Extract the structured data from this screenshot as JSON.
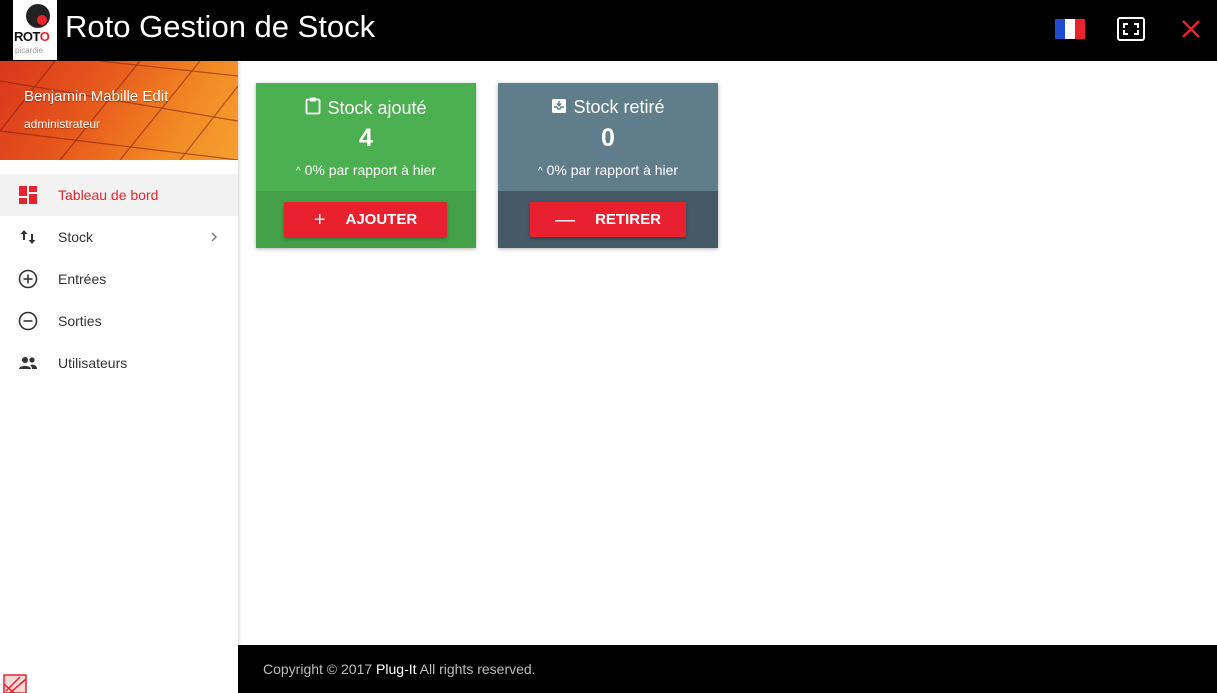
{
  "header": {
    "title": "Roto Gestion de Stock",
    "logo_text_ro": "ROT",
    "logo_text_o": "O",
    "logo_subtext": "picardie",
    "flag_colors": [
      "#1f4bd0",
      "#ffffff",
      "#e8232d"
    ]
  },
  "sidebar": {
    "user_name": "Benjamin Mabille Edit",
    "user_role": "administrateur",
    "items": [
      {
        "label": "Tableau de bord",
        "icon": "dashboard-icon",
        "active": true
      },
      {
        "label": "Stock",
        "icon": "swap-vert-icon",
        "has_submenu": true
      },
      {
        "label": "Entrées",
        "icon": "add-circle-icon"
      },
      {
        "label": "Sorties",
        "icon": "remove-circle-icon"
      },
      {
        "label": "Utilisateurs",
        "icon": "people-icon"
      }
    ]
  },
  "cards": {
    "added": {
      "title": "Stock ajouté",
      "value": "4",
      "comparison": "0% par rapport à hier",
      "button_symbol": "+",
      "button_label": "AJOUTER",
      "icon": "clipboard-icon"
    },
    "removed": {
      "title": "Stock retiré",
      "value": "0",
      "comparison": "0% par rapport à hier",
      "button_symbol": "—",
      "button_label": "RETIRER",
      "icon": "move-to-inbox-icon"
    }
  },
  "footer": {
    "prefix": "Copyright © 2017",
    "brand": "Plug-It",
    "suffix": "All rights reserved."
  },
  "colors": {
    "accent": "#e8202f",
    "green_card": "#4caf50",
    "grey_card": "#607d8b"
  }
}
